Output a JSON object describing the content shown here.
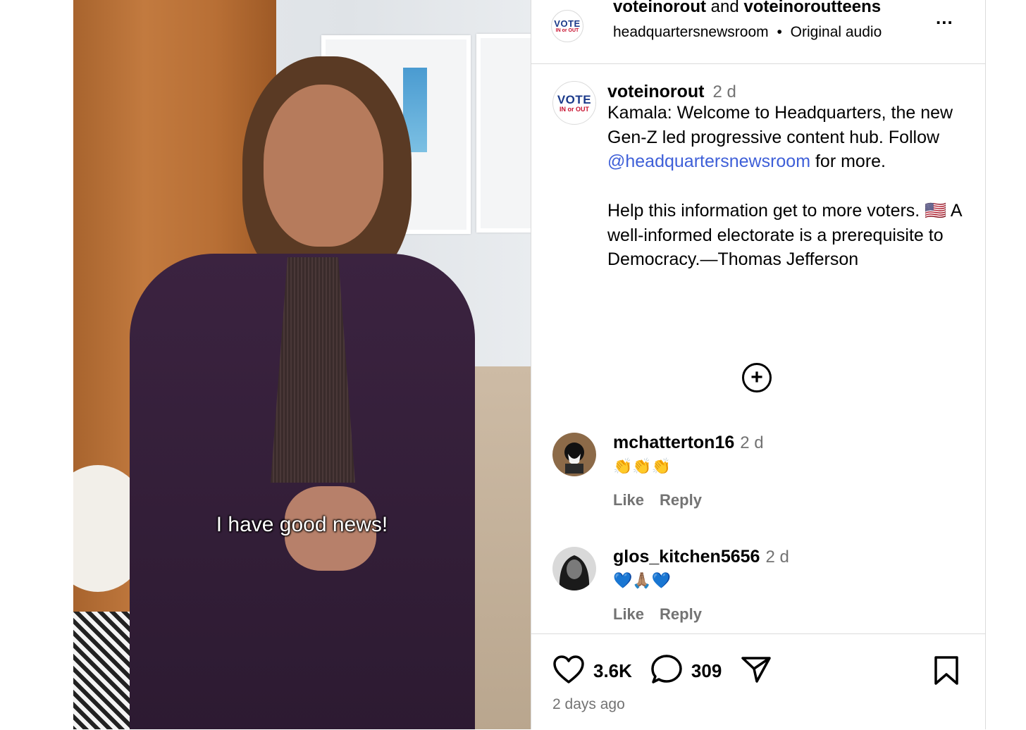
{
  "video": {
    "caption": "I have good news!"
  },
  "header": {
    "author1": "voteinorout",
    "joiner": " and ",
    "author2": "voteinoroutteens",
    "audio_source": "headquartersnewsroom",
    "separator": "•",
    "audio_label": "Original audio",
    "more_label": "..."
  },
  "avatar": {
    "vote": "VOTE",
    "inout": "IN or OUT"
  },
  "post": {
    "username": "voteinorout",
    "time": "2 d",
    "text_before": "Kamala: Welcome to Headquarters, the new Gen-Z led progressive content hub. Follow ",
    "mention": "@headquartersnewsroom",
    "text_after": " for more.\n\nHelp this information get to more voters. 🇺🇸 A well-informed electorate is a prerequisite to Democracy.—Thomas Jefferson"
  },
  "comments": [
    {
      "username": "mchatterton16",
      "time": "2 d",
      "text": "👏👏👏",
      "like": "Like",
      "reply": "Reply"
    },
    {
      "username": "glos_kitchen5656",
      "time": "2 d",
      "text": "💙🙏🏽💙",
      "like": "Like",
      "reply": "Reply"
    }
  ],
  "footer": {
    "likes": "3.6K",
    "comments": "309",
    "date": "2 days ago"
  },
  "colors": {
    "link": "#3e5fd8",
    "muted": "#737373",
    "vote_blue": "#1b3a8a",
    "vote_red": "#c8102e"
  }
}
